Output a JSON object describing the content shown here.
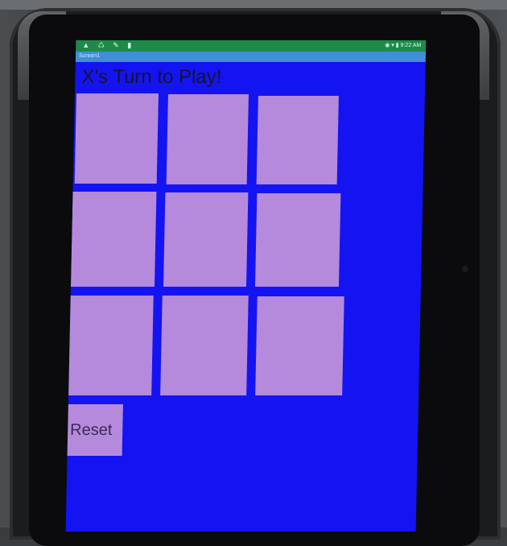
{
  "status_bar": {
    "left_icons": [
      "warning-icon",
      "recycle-icon",
      "wrench-icon",
      "battery-small-icon"
    ],
    "time": "9:22 AM"
  },
  "app_bar": {
    "title": "Screen1"
  },
  "game": {
    "turn_text": "X's Turn to Play!",
    "board": [
      "",
      "",
      "",
      "",
      "",
      "",
      "",
      "",
      ""
    ],
    "reset_label": "Reset"
  },
  "colors": {
    "screen_background": "#1414f2",
    "cell": "#b58adc",
    "status_bar": "#1e8a4a",
    "app_bar": "#3f8ed6"
  }
}
